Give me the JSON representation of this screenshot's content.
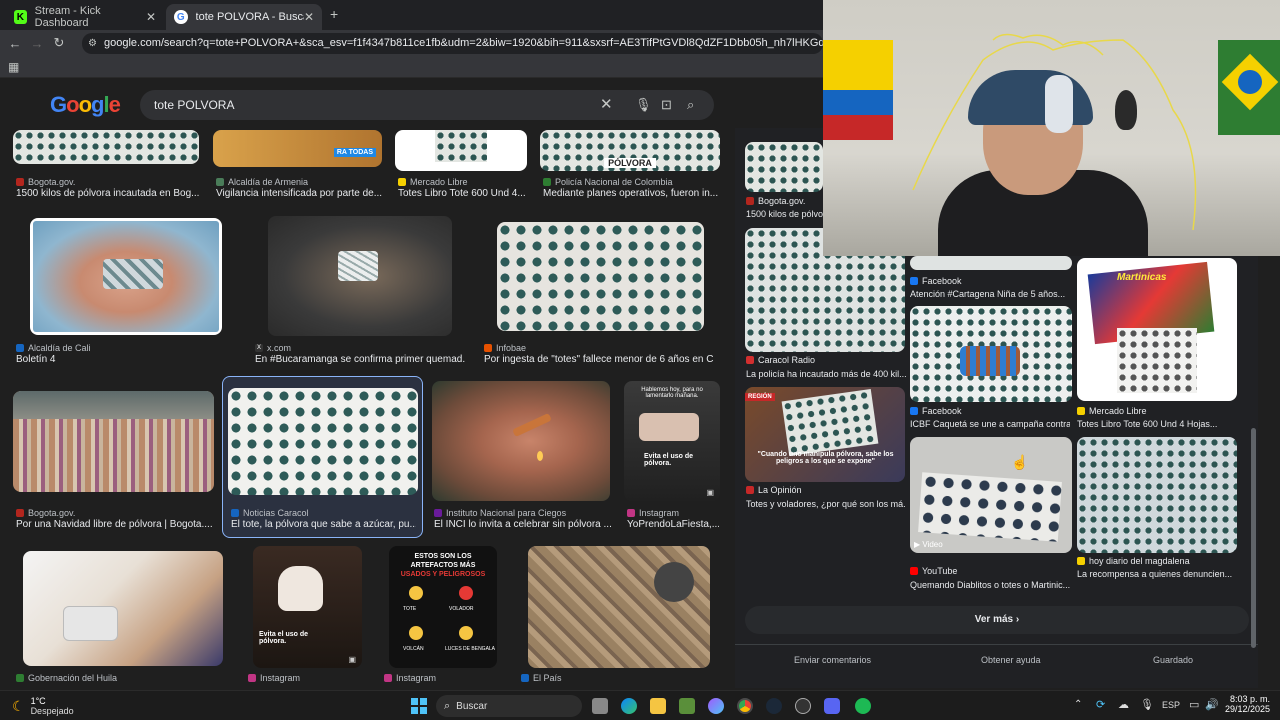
{
  "tabs": [
    {
      "title": "Stream - Kick Dashboard",
      "favicon": "kick-icon"
    },
    {
      "title": "tote POLVORA - Buscar con Go",
      "favicon": "google-icon"
    }
  ],
  "url": "google.com/search?q=tote+POLVORA+&sca_esv=f1f4347b811ce1fb&udm=2&biw=1920&bih=911&sxsrf=AE3TifPtGVDl8QdZF1Dbb05h_nh7lHKGdg%3A1767060182803&ei=",
  "google": {
    "logo": "Google",
    "query": "tote POLVORA"
  },
  "results": [
    {
      "source": "Bogota.gov.",
      "caption": "1500 kilos de pólvora incautada en Bog...",
      "color": "#b3261e"
    },
    {
      "source": "Alcaldía de Armenia",
      "caption": "Vigilancia intensificada por parte de...",
      "color": "#4a7c59"
    },
    {
      "source": "Mercado Libre",
      "caption": "Totes Libro Tote 600 Und 4...",
      "color": "#f5d000"
    },
    {
      "source": "Policía Nacional de Colombia",
      "caption": "Mediante planes operativos, fueron in...",
      "color": "#2e7d32"
    },
    {
      "source": "Alcaldía de Cali",
      "caption": "Boletín 4",
      "color": "#1565c0"
    },
    {
      "source": "x.com",
      "caption": "En #Bucaramanga se confirma primer quemad...",
      "color": "#333333"
    },
    {
      "source": "Infobae",
      "caption": "Por ingesta de \"totes\" fallece menor de 6 años en C...",
      "color": "#e65100"
    },
    {
      "source": "Bogota.gov.",
      "caption": "Por una Navidad libre de pólvora | Bogota....",
      "color": "#b3261e"
    },
    {
      "source": "Noticias Caracol",
      "caption": "El tote, la pólvora que sabe a azúcar, pu...",
      "color": "#1565c0"
    },
    {
      "source": "Instituto Nacional para Ciegos",
      "caption": "El INCI lo invita a celebrar sin pólvora ...",
      "color": "#6a1b9a"
    },
    {
      "source": "Instagram",
      "caption": "YoPrendoLaFiesta,...",
      "color": "#c13584"
    },
    {
      "source": "Gobernación del Huila",
      "caption": "",
      "color": "#2e7d32"
    },
    {
      "source": "Instagram",
      "caption": "",
      "color": "#c13584"
    },
    {
      "source": "Instagram",
      "caption": "",
      "color": "#c13584"
    },
    {
      "source": "El País",
      "caption": "",
      "color": "#1565c0"
    }
  ],
  "image_texts": {
    "polvora_sign": "PÓLVORA",
    "ra_todas": "RA TODAS",
    "hablemos": "Hablemos hoy, para no lamentarlo mañana.",
    "evita_1": "Evita el uso de pólvora.",
    "evita_2": "Evita el uso de pólvora.",
    "artefactos_title_1": "ESTOS SON LOS ARTEFACTOS MÁS",
    "artefactos_title_2": "USADOS Y PELIGROSOS",
    "art_items": [
      "TOTE",
      "VOLADOR",
      "VOLCÁN",
      "LUCES DE BENGALA"
    ]
  },
  "panel": {
    "main_source": "Bogota.gov.",
    "main_caption": "1500 kilos de pólvora...",
    "items": [
      {
        "source": "Facebook",
        "caption": "Atención #Cartagena Niña de 5 años...",
        "color": "#1877f2"
      },
      {
        "source": "Caracol Radio",
        "caption": "La policía ha incautado más de 400 kil...",
        "color": "#d32f2f"
      },
      {
        "source": "Facebook",
        "caption": "ICBF Caquetá se une a campaña contra...",
        "color": "#1877f2"
      },
      {
        "source": "Mercado Libre",
        "caption": "Totes Libro Tote 600 Und 4 Hojas...",
        "color": "#f5d000"
      },
      {
        "source": "La Opinión",
        "caption": "Totes y voladores, ¿por qué son los má...",
        "color": "#c62828"
      },
      {
        "source": "YouTube",
        "caption": "Quemando Diablitos o totes o Martinic...",
        "color": "#ff0000"
      },
      {
        "source": "hoy diario del magdalena",
        "caption": "La recompensa a quienes denuncien...",
        "color": "#f5d000"
      }
    ],
    "region_badge": "REGIÓN",
    "quote": "\"Cuando uno manipula pólvora, sabe los peligros a los que se expone\"",
    "video_label": "Video",
    "martinicas": "Martinicas",
    "ver_mas": "Ver más",
    "footer": [
      "Enviar comentarios",
      "Obtener ayuda",
      "Guardado"
    ]
  },
  "taskbar": {
    "weather_temp": "1°C",
    "weather_desc": "Despejado",
    "search_placeholder": "Buscar",
    "lang": "ESP",
    "time": "8:03 p. m.",
    "date": "29/12/2025"
  }
}
